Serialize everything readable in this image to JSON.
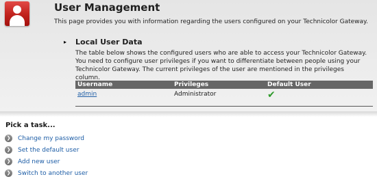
{
  "header": {
    "title": "User Management",
    "intro": "This page provides you with information regarding the users configured on your Technicolor Gateway."
  },
  "local_users": {
    "bullet": "▸",
    "title": "Local User Data",
    "description": "The table below shows the configured users who are able to access your Technicolor Gateway. You need to configure user privileges if you want to differentiate between people using your Technicolor Gateway. The current privileges of the user are mentioned in the privileges column.",
    "columns": [
      "Username",
      "Privileges",
      "Default User"
    ],
    "rows": [
      {
        "username": "admin",
        "privileges": "Administrator",
        "default_user": "✔"
      }
    ]
  },
  "tasks": {
    "title": "Pick a task...",
    "arrow": "❯",
    "items": [
      "Change my password",
      "Set the default user",
      "Add new user",
      "Switch to another user"
    ]
  },
  "colors": {
    "accent_red": "#c0211c",
    "link_blue": "#1d5da6",
    "check_green": "#2e9a2a",
    "table_header": "#666666"
  },
  "icons": {
    "page": "user-icon",
    "default_user": "checkmark-icon",
    "task": "arrow-circle-icon"
  }
}
